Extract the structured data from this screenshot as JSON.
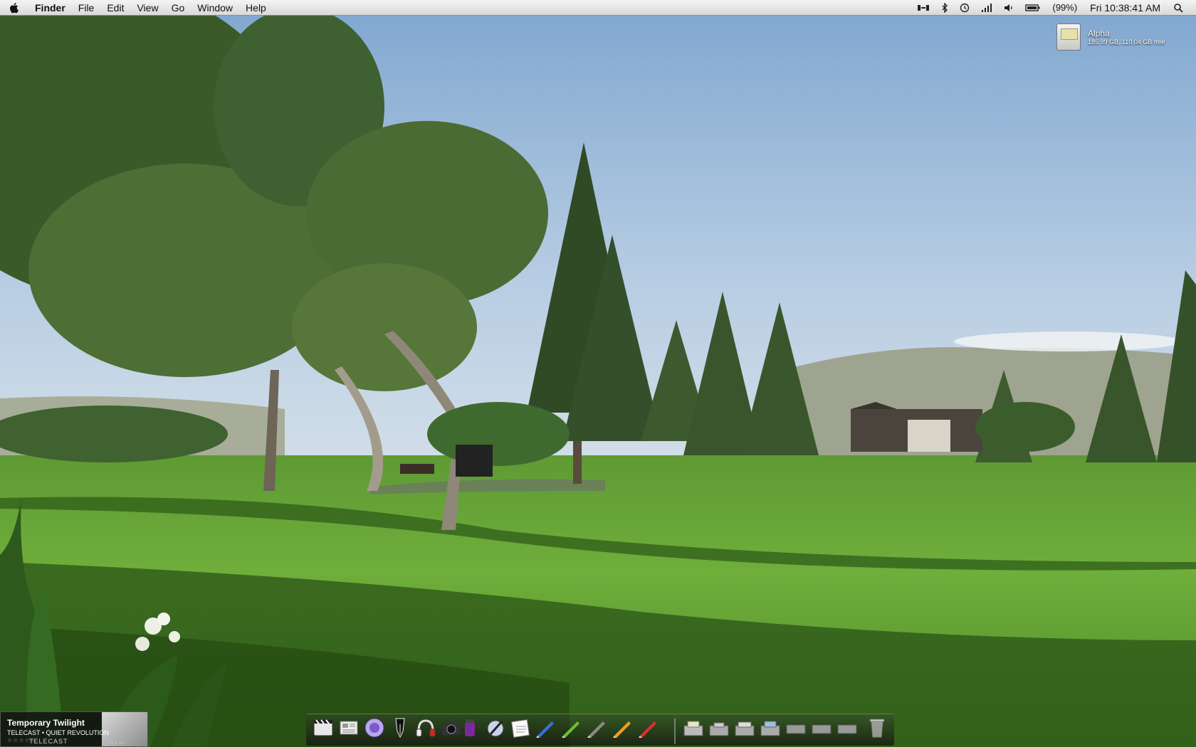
{
  "menubar": {
    "app_name": "Finder",
    "menus": [
      "File",
      "Edit",
      "View",
      "Go",
      "Window",
      "Help"
    ],
    "battery": "(99%)",
    "clock": "Fri 10:38:41 AM"
  },
  "desktop": {
    "volume": {
      "name": "Alpha",
      "info": "185.99 GB, 110.04 GB free"
    }
  },
  "now_playing": {
    "track": "Temporary Twilight",
    "artist": "TELECAST • QUIET REVOLUTION",
    "rating": "☆☆☆☆☆",
    "controls": "◂◂ ▸ ▸▸",
    "art_label": "TELECAST"
  },
  "dock": {
    "icons": [
      "clapperboard-icon",
      "newspaper-icon",
      "browser-orb-icon",
      "fountain-pen-icon",
      "headphones-icon",
      "camera-icon",
      "purple-jar-icon",
      "paintbrush-icon",
      "notepad-icon",
      "blue-pencil-icon",
      "green-pencil-icon",
      "gray-pencil-icon",
      "orange-pencil-icon",
      "red-pencil-icon",
      "stack-folder-1-icon",
      "stack-folder-2-icon",
      "stack-folder-3-icon",
      "stack-folder-4-icon",
      "stack-folder-5-icon",
      "stack-folder-6-icon",
      "stack-folder-7-icon",
      "trash-icon"
    ],
    "colors": {
      "blue-pencil": "#3a6fd8",
      "green-pencil": "#6bbf2f",
      "gray-pencil": "#8a8a8a",
      "orange-pencil": "#f0a020",
      "red-pencil": "#d93030"
    }
  }
}
